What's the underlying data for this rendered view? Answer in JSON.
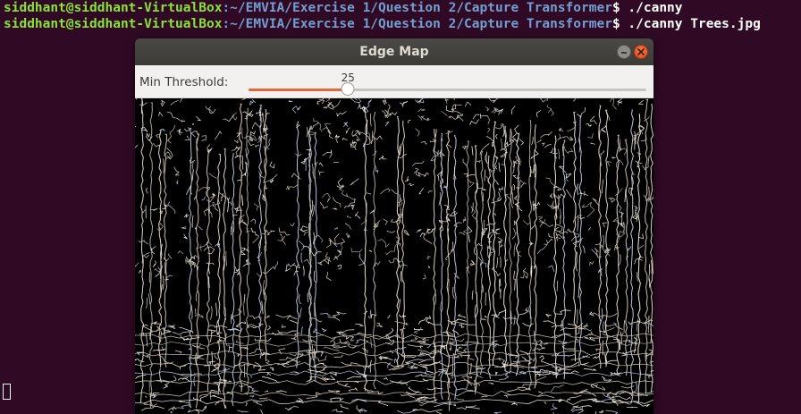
{
  "terminal": {
    "line1": {
      "user": "siddhant@siddhant-VirtualBox",
      "path": ":~/EMVIA/Exercise 1/Question 2/Capture Transformer",
      "prompt": "$ ",
      "command": "./canny"
    },
    "line2": {
      "user": "siddhant@siddhant-VirtualBox",
      "path": ":~/EMVIA/Exercise 1/Question 2/Capture Transformer",
      "prompt": "$ ",
      "command": "./canny Trees.jpg"
    }
  },
  "window": {
    "title": "Edge Map",
    "slider": {
      "label": "Min Threshold:",
      "value": "25",
      "fraction": 0.25
    },
    "image": {
      "content": "canny-edge-map-trees",
      "edge_color": "#d8d0c4",
      "background": "#000000"
    }
  },
  "colors": {
    "terminal_bg": "#300a24",
    "user": "#8ae234",
    "path": "#729fcf",
    "slider_accent": "#e0693c",
    "close_button": "#df4a16"
  }
}
